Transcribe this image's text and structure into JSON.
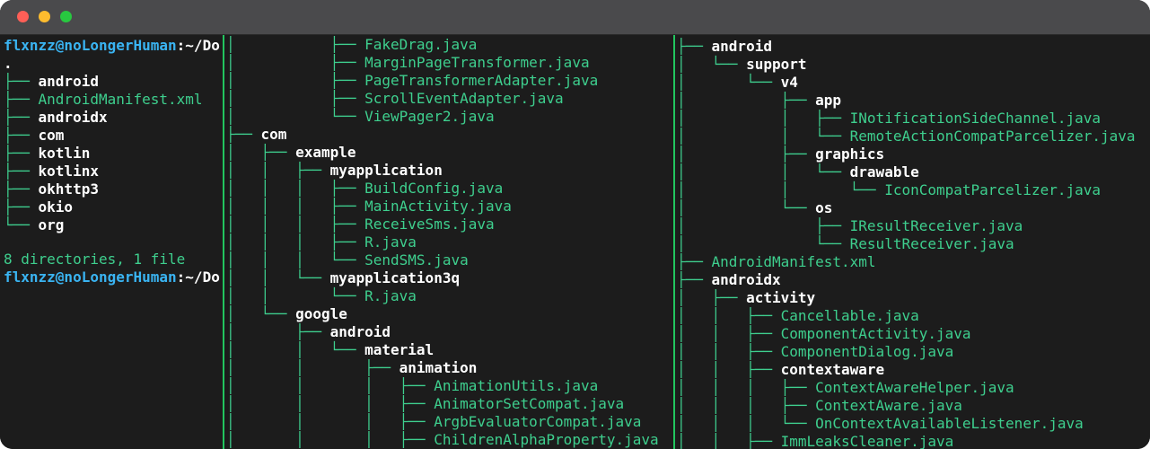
{
  "window": {
    "controls": [
      "close",
      "minimize",
      "maximize"
    ]
  },
  "left_pane": {
    "prompt_top": {
      "user_host": "flxnzz@noLongerHuman",
      "colon": ":",
      "path": "~/Do"
    },
    "root": ".",
    "entries": [
      {
        "branch": "├── ",
        "name": "android",
        "kind": "dir"
      },
      {
        "branch": "├── ",
        "name": "AndroidManifest.xml",
        "kind": "file"
      },
      {
        "branch": "├── ",
        "name": "androidx",
        "kind": "dir"
      },
      {
        "branch": "├── ",
        "name": "com",
        "kind": "dir"
      },
      {
        "branch": "├── ",
        "name": "kotlin",
        "kind": "dir"
      },
      {
        "branch": "├── ",
        "name": "kotlinx",
        "kind": "dir"
      },
      {
        "branch": "├── ",
        "name": "okhttp3",
        "kind": "dir"
      },
      {
        "branch": "├── ",
        "name": "okio",
        "kind": "dir"
      },
      {
        "branch": "└── ",
        "name": "org",
        "kind": "dir"
      }
    ],
    "summary": "8 directories, 1 file",
    "prompt_bottom": {
      "user_host": "flxnzz@noLongerHuman",
      "colon": ":",
      "path": "~/Do"
    }
  },
  "mid_pane": {
    "lines": [
      {
        "prefix": "│           ├── ",
        "name": "FakeDrag.java",
        "kind": "file"
      },
      {
        "prefix": "│           ├── ",
        "name": "MarginPageTransformer.java",
        "kind": "file"
      },
      {
        "prefix": "│           ├── ",
        "name": "PageTransformerAdapter.java",
        "kind": "file"
      },
      {
        "prefix": "│           ├── ",
        "name": "ScrollEventAdapter.java",
        "kind": "file"
      },
      {
        "prefix": "│           └── ",
        "name": "ViewPager2.java",
        "kind": "file"
      },
      {
        "prefix": "├── ",
        "name": "com",
        "kind": "dir"
      },
      {
        "prefix": "│   ├── ",
        "name": "example",
        "kind": "dir"
      },
      {
        "prefix": "│   │   ├── ",
        "name": "myapplication",
        "kind": "dir"
      },
      {
        "prefix": "│   │   │   ├── ",
        "name": "BuildConfig.java",
        "kind": "file"
      },
      {
        "prefix": "│   │   │   ├── ",
        "name": "MainActivity.java",
        "kind": "file"
      },
      {
        "prefix": "│   │   │   ├── ",
        "name": "ReceiveSms.java",
        "kind": "file"
      },
      {
        "prefix": "│   │   │   ├── ",
        "name": "R.java",
        "kind": "file"
      },
      {
        "prefix": "│   │   │   └── ",
        "name": "SendSMS.java",
        "kind": "file"
      },
      {
        "prefix": "│   │   └── ",
        "name": "myapplication3q",
        "kind": "dir"
      },
      {
        "prefix": "│   │       └── ",
        "name": "R.java",
        "kind": "file"
      },
      {
        "prefix": "│   └── ",
        "name": "google",
        "kind": "dir"
      },
      {
        "prefix": "│       ├── ",
        "name": "android",
        "kind": "dir"
      },
      {
        "prefix": "│       │   └── ",
        "name": "material",
        "kind": "dir"
      },
      {
        "prefix": "│       │       ├── ",
        "name": "animation",
        "kind": "dir"
      },
      {
        "prefix": "│       │       │   ├── ",
        "name": "AnimationUtils.java",
        "kind": "file"
      },
      {
        "prefix": "│       │       │   ├── ",
        "name": "AnimatorSetCompat.java",
        "kind": "file"
      },
      {
        "prefix": "│       │       │   ├── ",
        "name": "ArgbEvaluatorCompat.java",
        "kind": "file"
      },
      {
        "prefix": "│       │       │   ├── ",
        "name": "ChildrenAlphaProperty.java",
        "kind": "file"
      },
      {
        "prefix": "│       │       │   ├── ",
        "name": "",
        "kind": "file"
      }
    ]
  },
  "right_pane": {
    "lines": [
      {
        "prefix": "├── ",
        "name": "android",
        "kind": "dir"
      },
      {
        "prefix": "│   └── ",
        "name": "support",
        "kind": "dir"
      },
      {
        "prefix": "│       └── ",
        "name": "v4",
        "kind": "dir"
      },
      {
        "prefix": "│           ├── ",
        "name": "app",
        "kind": "dir"
      },
      {
        "prefix": "│           │   ├── ",
        "name": "INotificationSideChannel.java",
        "kind": "file"
      },
      {
        "prefix": "│           │   └── ",
        "name": "RemoteActionCompatParcelizer.java",
        "kind": "file"
      },
      {
        "prefix": "│           ├── ",
        "name": "graphics",
        "kind": "dir"
      },
      {
        "prefix": "│           │   └── ",
        "name": "drawable",
        "kind": "dir"
      },
      {
        "prefix": "│           │       └── ",
        "name": "IconCompatParcelizer.java",
        "kind": "file"
      },
      {
        "prefix": "│           └── ",
        "name": "os",
        "kind": "dir"
      },
      {
        "prefix": "│               ├── ",
        "name": "IResultReceiver.java",
        "kind": "file"
      },
      {
        "prefix": "│               └── ",
        "name": "ResultReceiver.java",
        "kind": "file"
      },
      {
        "prefix": "├── ",
        "name": "AndroidManifest.xml",
        "kind": "file"
      },
      {
        "prefix": "├── ",
        "name": "androidx",
        "kind": "dir"
      },
      {
        "prefix": "│   ├── ",
        "name": "activity",
        "kind": "dir"
      },
      {
        "prefix": "│   │   ├── ",
        "name": "Cancellable.java",
        "kind": "file"
      },
      {
        "prefix": "│   │   ├── ",
        "name": "ComponentActivity.java",
        "kind": "file"
      },
      {
        "prefix": "│   │   ├── ",
        "name": "ComponentDialog.java",
        "kind": "file"
      },
      {
        "prefix": "│   │   ├── ",
        "name": "contextaware",
        "kind": "dir"
      },
      {
        "prefix": "│   │   │   ├── ",
        "name": "ContextAwareHelper.java",
        "kind": "file"
      },
      {
        "prefix": "│   │   │   ├── ",
        "name": "ContextAware.java",
        "kind": "file"
      },
      {
        "prefix": "│   │   │   └── ",
        "name": "OnContextAvailableListener.java",
        "kind": "file"
      },
      {
        "prefix": "│   │   ├── ",
        "name": "ImmLeaksCleaner.java",
        "kind": "file"
      },
      {
        "prefix": "│   │   ├── ",
        "name": "",
        "kind": "file"
      }
    ]
  }
}
